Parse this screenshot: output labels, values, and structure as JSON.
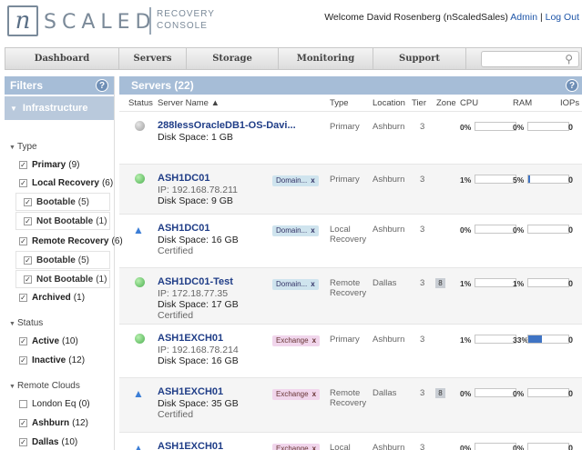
{
  "header": {
    "logo_letter": "n",
    "logo_word": "SCALED",
    "logo_sub_1": "RECOVERY",
    "logo_sub_2": "CONSOLE",
    "welcome": "Welcome David Rosenberg (nScaledSales)",
    "admin_link": "Admin",
    "separator": "|",
    "logout_link": "Log Out"
  },
  "nav": {
    "items": [
      "Dashboard",
      "Servers",
      "Storage",
      "Monitoring",
      "Support"
    ],
    "search_placeholder": ""
  },
  "sidebar": {
    "title": "Filters",
    "section": "Infrastructure",
    "type_group": {
      "title": "Type",
      "items": [
        {
          "label": "Primary",
          "count": "(9)",
          "checked": true
        },
        {
          "label": "Local Recovery",
          "count": "(6)",
          "checked": true
        },
        {
          "label": "Bootable",
          "count": "(5)",
          "checked": true,
          "sub": true
        },
        {
          "label": "Not Bootable",
          "count": "(1)",
          "checked": true,
          "sub": true
        },
        {
          "label": "Remote Recovery",
          "count": "(6)",
          "checked": true
        },
        {
          "label": "Bootable",
          "count": "(5)",
          "checked": true,
          "sub": true
        },
        {
          "label": "Not Bootable",
          "count": "(1)",
          "checked": true,
          "sub": true
        },
        {
          "label": "Archived",
          "count": "(1)",
          "checked": true
        }
      ]
    },
    "status_group": {
      "title": "Status",
      "items": [
        {
          "label": "Active",
          "count": "(10)",
          "checked": true
        },
        {
          "label": "Inactive",
          "count": "(12)",
          "checked": true
        }
      ]
    },
    "clouds_group": {
      "title": "Remote Clouds",
      "items": [
        {
          "label": "London Eq",
          "count": "(0)",
          "checked": false
        },
        {
          "label": "Ashburn",
          "count": "(12)",
          "checked": true
        },
        {
          "label": "Dallas",
          "count": "(10)",
          "checked": true
        }
      ]
    }
  },
  "main": {
    "title": "Servers (22)",
    "columns": {
      "status": "Status",
      "name": "Server Name ▲",
      "type": "Type",
      "location": "Location",
      "tier": "Tier",
      "zone": "Zone",
      "cpu": "CPU",
      "ram": "RAM",
      "iops": "IOPs"
    },
    "rows": [
      {
        "status": "inactive",
        "name": "288lessOracleDB1-OS-Davi...",
        "ip": "",
        "disk": "Disk Space: 1 GB",
        "note": "",
        "tag": "",
        "tag_kind": "",
        "type_1": "Primary",
        "type_2": "",
        "location": "Ashburn",
        "tier": "3",
        "zone": "",
        "cpu": "0%",
        "cpu_fill": 0,
        "ram": "0%",
        "ram_fill": 0,
        "iops": "0"
      },
      {
        "status": "active",
        "name": "ASH1DC01",
        "ip": "IP: 192.168.78.211",
        "disk": "Disk Space: 9 GB",
        "note": "",
        "tag": "Domain...",
        "tag_kind": "domain",
        "type_1": "Primary",
        "type_2": "",
        "location": "Ashburn",
        "tier": "3",
        "zone": "",
        "cpu": "1%",
        "cpu_fill": 0.01,
        "ram": "5%",
        "ram_fill": 0.05,
        "iops": "0"
      },
      {
        "status": "recovery",
        "name": "ASH1DC01",
        "ip": "",
        "disk": "Disk Space: 16 GB",
        "note": "Certified",
        "tag": "Domain...",
        "tag_kind": "domain",
        "type_1": "Local",
        "type_2": "Recovery",
        "location": "Ashburn",
        "tier": "3",
        "zone": "",
        "cpu": "0%",
        "cpu_fill": 0,
        "ram": "0%",
        "ram_fill": 0,
        "iops": "0"
      },
      {
        "status": "active",
        "name": "ASH1DC01-Test",
        "ip": "IP: 172.18.77.35",
        "disk": "Disk Space: 17 GB",
        "note": "Certified",
        "tag": "Domain...",
        "tag_kind": "domain",
        "type_1": "Remote",
        "type_2": "Recovery",
        "location": "Dallas",
        "tier": "3",
        "zone": "8",
        "cpu": "1%",
        "cpu_fill": 0.01,
        "ram": "1%",
        "ram_fill": 0.01,
        "iops": "0"
      },
      {
        "status": "active",
        "name": "ASH1EXCH01",
        "ip": "IP: 192.168.78.214",
        "disk": "Disk Space: 16 GB",
        "note": "",
        "tag": "Exchange",
        "tag_kind": "exchange",
        "type_1": "Primary",
        "type_2": "",
        "location": "Ashburn",
        "tier": "3",
        "zone": "",
        "cpu": "1%",
        "cpu_fill": 0.01,
        "ram": "33%",
        "ram_fill": 0.33,
        "iops": "0"
      },
      {
        "status": "recovery",
        "name": "ASH1EXCH01",
        "ip": "",
        "disk": "Disk Space: 35 GB",
        "note": "Certified",
        "tag": "Exchange",
        "tag_kind": "exchange",
        "type_1": "Remote",
        "type_2": "Recovery",
        "location": "Dallas",
        "tier": "3",
        "zone": "8",
        "cpu": "0%",
        "cpu_fill": 0,
        "ram": "0%",
        "ram_fill": 0,
        "iops": "0"
      },
      {
        "status": "recovery",
        "name": "ASH1EXCH01",
        "ip": "",
        "disk": "",
        "note": "",
        "tag": "Exchange",
        "tag_kind": "exchange",
        "type_1": "Local",
        "type_2": "",
        "location": "Ashburn",
        "tier": "3",
        "zone": "",
        "cpu": "0%",
        "cpu_fill": 0,
        "ram": "0%",
        "ram_fill": 0,
        "iops": "0"
      }
    ]
  },
  "icons": {
    "search": "search-icon",
    "help": "help-icon",
    "status_active": "status-active-icon",
    "status_inactive": "status-inactive-icon",
    "status_recovery": "recovery-upload-icon"
  },
  "colors": {
    "accent_header": "#a6bdd7",
    "link": "#1f56a8",
    "server_name": "#1f3d87",
    "bar_fill": "#3f74c4",
    "domain_tag": "#cfe4ee",
    "exchange_tag": "#f1d6ec"
  }
}
